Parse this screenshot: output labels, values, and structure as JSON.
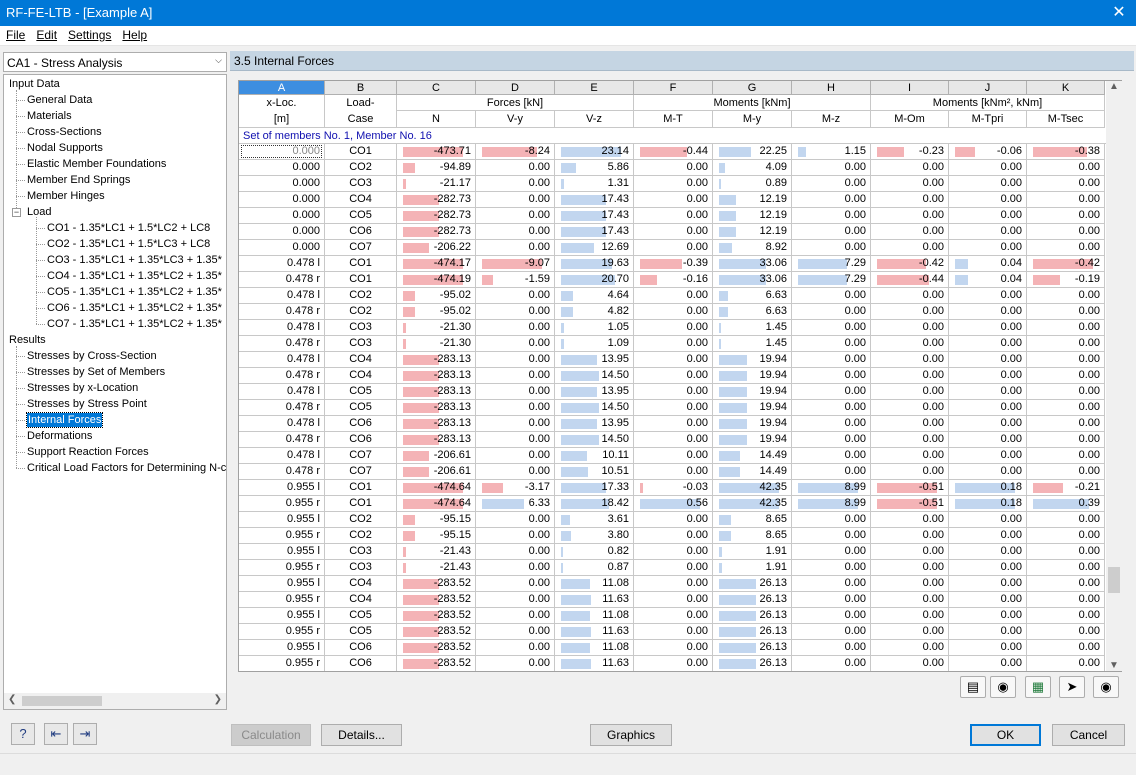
{
  "window": {
    "title": "RF-FE-LTB - [Example A]",
    "close_glyph": "✕"
  },
  "menu": [
    {
      "label": "File",
      "accel": 0
    },
    {
      "label": "Edit",
      "accel": 0
    },
    {
      "label": "Settings",
      "accel": 0
    },
    {
      "label": "Help",
      "accel": 0
    }
  ],
  "case_select": {
    "value": "CA1 - Stress Analysis"
  },
  "nav": [
    {
      "label": "Input Data",
      "level": 0
    },
    {
      "label": "General Data",
      "level": 1
    },
    {
      "label": "Materials",
      "level": 1
    },
    {
      "label": "Cross-Sections",
      "level": 1
    },
    {
      "label": "Nodal Supports",
      "level": 1
    },
    {
      "label": "Elastic Member Foundations",
      "level": 1
    },
    {
      "label": "Member End Springs",
      "level": 1
    },
    {
      "label": "Member Hinges",
      "level": 1
    },
    {
      "label": "Load",
      "level": 1,
      "expander": "−"
    },
    {
      "label": "CO1 - 1.35*LC1 + 1.5*LC2 + LC8",
      "level": 2
    },
    {
      "label": "CO2 - 1.35*LC1 + 1.5*LC3 + LC8",
      "level": 2
    },
    {
      "label": "CO3 - 1.35*LC1 + 1.35*LC3 + 1.35*",
      "level": 2
    },
    {
      "label": "CO4 - 1.35*LC1 + 1.35*LC2 + 1.35*",
      "level": 2
    },
    {
      "label": "CO5 - 1.35*LC1 + 1.35*LC2 + 1.35*",
      "level": 2
    },
    {
      "label": "CO6 - 1.35*LC1 + 1.35*LC2 + 1.35*",
      "level": 2
    },
    {
      "label": "CO7 - 1.35*LC1 + 1.35*LC2 + 1.35*",
      "level": 2
    },
    {
      "label": "Results",
      "level": 0
    },
    {
      "label": "Stresses by Cross-Section",
      "level": 1
    },
    {
      "label": "Stresses by Set of Members",
      "level": 1
    },
    {
      "label": "Stresses by x-Location",
      "level": 1
    },
    {
      "label": "Stresses by Stress Point",
      "level": 1
    },
    {
      "label": "Internal Forces",
      "level": 1,
      "selected": true
    },
    {
      "label": "Deformations",
      "level": 1
    },
    {
      "label": "Support Reaction Forces",
      "level": 1
    },
    {
      "label": "Critical Load Factors for Determining N-cr",
      "level": 1
    }
  ],
  "section_title": "3.5 Internal Forces",
  "table": {
    "letters": [
      "A",
      "B",
      "C",
      "D",
      "E",
      "F",
      "G",
      "H",
      "I",
      "J",
      "K"
    ],
    "groups": [
      {
        "label": "Forces [kN]",
        "from": 2,
        "span": 3
      },
      {
        "label": "Moments [kNm]",
        "from": 5,
        "span": 3
      },
      {
        "label": "Moments [kNm², kNm]",
        "from": 8,
        "span": 3
      }
    ],
    "head1": [
      "x-Loc.",
      "Load-"
    ],
    "head2": [
      "[m]",
      "Case",
      "N",
      "V-y",
      "V-z",
      "M-T",
      "M-y",
      "M-z",
      "M-Om",
      "M-Tpri",
      "M-Tsec"
    ],
    "set_label": "Set of members No. 1, Member No. 16",
    "rows": [
      [
        "0.000",
        "CO1",
        "-473.71",
        "-8.24",
        "23.14",
        "-0.44",
        "22.25",
        "1.15",
        "-0.23",
        "-0.06",
        "-0.38"
      ],
      [
        "0.000",
        "CO2",
        "-94.89",
        "0.00",
        "5.86",
        "0.00",
        "4.09",
        "0.00",
        "0.00",
        "0.00",
        "0.00"
      ],
      [
        "0.000",
        "CO3",
        "-21.17",
        "0.00",
        "1.31",
        "0.00",
        "0.89",
        "0.00",
        "0.00",
        "0.00",
        "0.00"
      ],
      [
        "0.000",
        "CO4",
        "-282.73",
        "0.00",
        "17.43",
        "0.00",
        "12.19",
        "0.00",
        "0.00",
        "0.00",
        "0.00"
      ],
      [
        "0.000",
        "CO5",
        "-282.73",
        "0.00",
        "17.43",
        "0.00",
        "12.19",
        "0.00",
        "0.00",
        "0.00",
        "0.00"
      ],
      [
        "0.000",
        "CO6",
        "-282.73",
        "0.00",
        "17.43",
        "0.00",
        "12.19",
        "0.00",
        "0.00",
        "0.00",
        "0.00"
      ],
      [
        "0.000",
        "CO7",
        "-206.22",
        "0.00",
        "12.69",
        "0.00",
        "8.92",
        "0.00",
        "0.00",
        "0.00",
        "0.00"
      ],
      [
        "0.478 l",
        "CO1",
        "-474.17",
        "-9.07",
        "19.63",
        "-0.39",
        "33.06",
        "7.29",
        "-0.42",
        "0.04",
        "-0.42"
      ],
      [
        "0.478 r",
        "CO1",
        "-474.19",
        "-1.59",
        "20.70",
        "-0.16",
        "33.06",
        "7.29",
        "-0.44",
        "0.04",
        "-0.19"
      ],
      [
        "0.478 l",
        "CO2",
        "-95.02",
        "0.00",
        "4.64",
        "0.00",
        "6.63",
        "0.00",
        "0.00",
        "0.00",
        "0.00"
      ],
      [
        "0.478 r",
        "CO2",
        "-95.02",
        "0.00",
        "4.82",
        "0.00",
        "6.63",
        "0.00",
        "0.00",
        "0.00",
        "0.00"
      ],
      [
        "0.478 l",
        "CO3",
        "-21.30",
        "0.00",
        "1.05",
        "0.00",
        "1.45",
        "0.00",
        "0.00",
        "0.00",
        "0.00"
      ],
      [
        "0.478 r",
        "CO3",
        "-21.30",
        "0.00",
        "1.09",
        "0.00",
        "1.45",
        "0.00",
        "0.00",
        "0.00",
        "0.00"
      ],
      [
        "0.478 l",
        "CO4",
        "-283.13",
        "0.00",
        "13.95",
        "0.00",
        "19.94",
        "0.00",
        "0.00",
        "0.00",
        "0.00"
      ],
      [
        "0.478 r",
        "CO4",
        "-283.13",
        "0.00",
        "14.50",
        "0.00",
        "19.94",
        "0.00",
        "0.00",
        "0.00",
        "0.00"
      ],
      [
        "0.478 l",
        "CO5",
        "-283.13",
        "0.00",
        "13.95",
        "0.00",
        "19.94",
        "0.00",
        "0.00",
        "0.00",
        "0.00"
      ],
      [
        "0.478 r",
        "CO5",
        "-283.13",
        "0.00",
        "14.50",
        "0.00",
        "19.94",
        "0.00",
        "0.00",
        "0.00",
        "0.00"
      ],
      [
        "0.478 l",
        "CO6",
        "-283.13",
        "0.00",
        "13.95",
        "0.00",
        "19.94",
        "0.00",
        "0.00",
        "0.00",
        "0.00"
      ],
      [
        "0.478 r",
        "CO6",
        "-283.13",
        "0.00",
        "14.50",
        "0.00",
        "19.94",
        "0.00",
        "0.00",
        "0.00",
        "0.00"
      ],
      [
        "0.478 l",
        "CO7",
        "-206.61",
        "0.00",
        "10.11",
        "0.00",
        "14.49",
        "0.00",
        "0.00",
        "0.00",
        "0.00"
      ],
      [
        "0.478 r",
        "CO7",
        "-206.61",
        "0.00",
        "10.51",
        "0.00",
        "14.49",
        "0.00",
        "0.00",
        "0.00",
        "0.00"
      ],
      [
        "0.955 l",
        "CO1",
        "-474.64",
        "-3.17",
        "17.33",
        "-0.03",
        "42.35",
        "8.99",
        "-0.51",
        "0.18",
        "-0.21"
      ],
      [
        "0.955 r",
        "CO1",
        "-474.64",
        "6.33",
        "18.42",
        "0.56",
        "42.35",
        "8.99",
        "-0.51",
        "0.18",
        "0.39"
      ],
      [
        "0.955 l",
        "CO2",
        "-95.15",
        "0.00",
        "3.61",
        "0.00",
        "8.65",
        "0.00",
        "0.00",
        "0.00",
        "0.00"
      ],
      [
        "0.955 r",
        "CO2",
        "-95.15",
        "0.00",
        "3.80",
        "0.00",
        "8.65",
        "0.00",
        "0.00",
        "0.00",
        "0.00"
      ],
      [
        "0.955 l",
        "CO3",
        "-21.43",
        "0.00",
        "0.82",
        "0.00",
        "1.91",
        "0.00",
        "0.00",
        "0.00",
        "0.00"
      ],
      [
        "0.955 r",
        "CO3",
        "-21.43",
        "0.00",
        "0.87",
        "0.00",
        "1.91",
        "0.00",
        "0.00",
        "0.00",
        "0.00"
      ],
      [
        "0.955 l",
        "CO4",
        "-283.52",
        "0.00",
        "11.08",
        "0.00",
        "26.13",
        "0.00",
        "0.00",
        "0.00",
        "0.00"
      ],
      [
        "0.955 r",
        "CO4",
        "-283.52",
        "0.00",
        "11.63",
        "0.00",
        "26.13",
        "0.00",
        "0.00",
        "0.00",
        "0.00"
      ],
      [
        "0.955 l",
        "CO5",
        "-283.52",
        "0.00",
        "11.08",
        "0.00",
        "26.13",
        "0.00",
        "0.00",
        "0.00",
        "0.00"
      ],
      [
        "0.955 r",
        "CO5",
        "-283.52",
        "0.00",
        "11.63",
        "0.00",
        "26.13",
        "0.00",
        "0.00",
        "0.00",
        "0.00"
      ],
      [
        "0.955 l",
        "CO6",
        "-283.52",
        "0.00",
        "11.08",
        "0.00",
        "26.13",
        "0.00",
        "0.00",
        "0.00",
        "0.00"
      ],
      [
        "0.955 r",
        "CO6",
        "-283.52",
        "0.00",
        "11.63",
        "0.00",
        "26.13",
        "0.00",
        "0.00",
        "0.00",
        "0.00"
      ]
    ]
  },
  "toolbar_icons": [
    "table-settings-icon",
    "result-colors-icon",
    "excel-export-icon",
    "select-in-graphic-icon",
    "view-icon"
  ],
  "buttons": {
    "calculation": "Calculation",
    "details": "Details...",
    "graphics": "Graphics",
    "ok": "OK",
    "cancel": "Cancel"
  },
  "colors": {
    "title_bar": "#0078d7",
    "section_header": "#c5d5e3",
    "negative_bar": "#f4b3b6",
    "positive_bar": "#c2d6ef",
    "selected_column": "#3d8ee0"
  }
}
